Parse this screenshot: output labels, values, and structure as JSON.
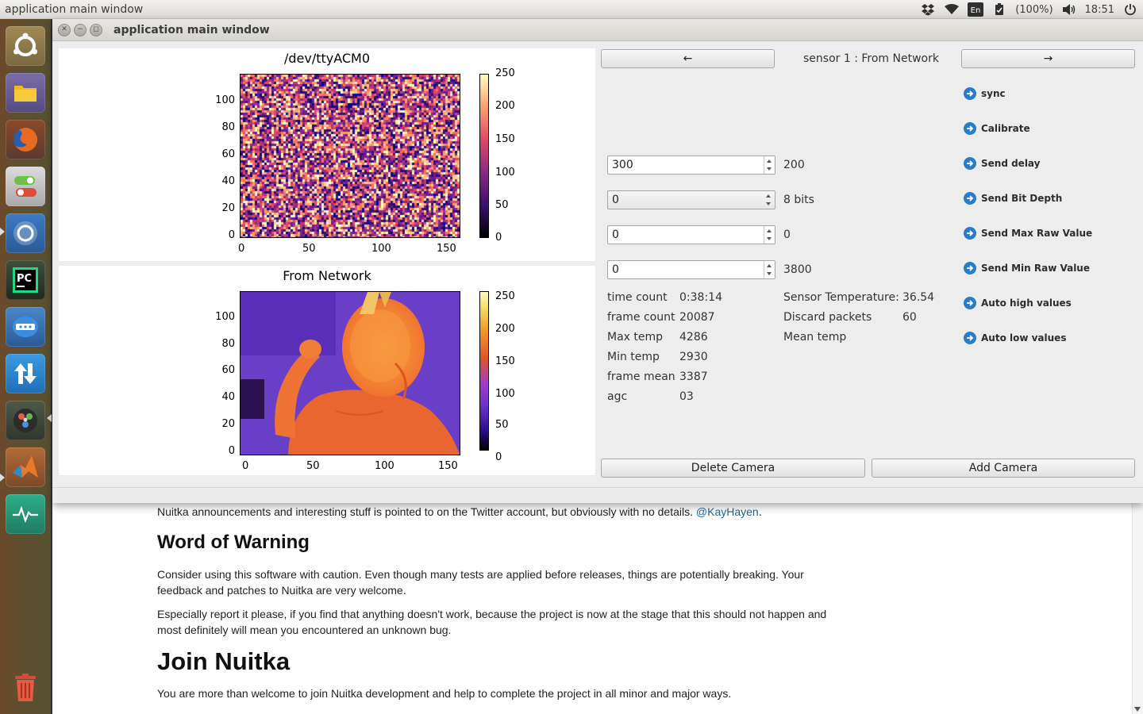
{
  "top_panel": {
    "title": "application main window",
    "keyboard": "En",
    "battery": "(100%)",
    "clock": "18:51"
  },
  "window": {
    "title": "application main window"
  },
  "plot_top": {
    "title": "/dev/ttyACM0",
    "y_ticks": [
      "100",
      "80",
      "60",
      "40",
      "20",
      "0"
    ],
    "x_ticks": [
      "0",
      "50",
      "100",
      "150"
    ],
    "cbar_ticks": [
      "250",
      "200",
      "150",
      "100",
      "50",
      "0"
    ]
  },
  "plot_bottom": {
    "title": "From Network",
    "y_ticks": [
      "100",
      "80",
      "60",
      "40",
      "20",
      "0"
    ],
    "x_ticks": [
      "0",
      "50",
      "100",
      "150"
    ],
    "cbar_ticks": [
      "250",
      "200",
      "150",
      "100",
      "50",
      "0"
    ]
  },
  "nav": {
    "prev_label": "←",
    "next_label": "→",
    "sensor_label": "sensor 1 : From Network"
  },
  "inputs": {
    "send_delay": {
      "value": "300",
      "readout": "200"
    },
    "bit_depth": {
      "value": "0",
      "readout": "8 bits"
    },
    "max_raw": {
      "value": "0",
      "readout": "0"
    },
    "min_raw": {
      "value": "0",
      "readout": "3800"
    }
  },
  "stats": {
    "time_count_label": "time count",
    "time_count": "0:38:14",
    "frame_count_label": "frame count",
    "frame_count": "20087",
    "max_temp_label": "Max temp",
    "max_temp": "4286",
    "min_temp_label": "Min temp",
    "min_temp": "2930",
    "frame_mean_label": "frame mean",
    "frame_mean": "3387",
    "agc_label": "agc",
    "agc": "03",
    "sensor_temp_label": "Sensor Temperature:",
    "sensor_temp": "36.54",
    "discard_label": "Discard packets",
    "discard": "60",
    "mean_temp_label": "Mean temp"
  },
  "commands": [
    "sync",
    "Calibrate",
    "Send delay",
    "Send Bit Depth",
    "Send Max Raw Value",
    "Send Min Raw Value",
    "Auto high values",
    "Auto low values"
  ],
  "bottom_buttons": {
    "delete": "Delete Camera",
    "add": "Add Camera"
  },
  "browser": {
    "intro": "Nuitka announcements and interesting stuff is pointed to on the Twitter account, but obviously with no details.",
    "intro_link": "@KayHayen",
    "h_warning": "Word of Warning",
    "p_warning": "Consider using this software with caution. Even though many tests are applied before releases, things are potentially breaking. Your feedback and patches to Nuitka are very welcome.",
    "p_report": "Especially report it please, if you find that anything doesn't work, because the project is now at the stage that this should not happen and most definitely will mean you encountered an unknown bug.",
    "h_join": "Join Nuitka",
    "p_join": "You are more than welcome to join Nuitka development and help to complete the project in all minor and major ways."
  },
  "colors": {
    "launcher": "#5c5030",
    "cmd_icon": "#2b7cc8",
    "link": "#1a6496"
  },
  "icons": [
    "ubuntu-logo-icon",
    "files-icon",
    "firefox-icon",
    "settings-toggle-icon",
    "chromium-icon",
    "pycharm-icon",
    "remmina-icon",
    "transfer-icon",
    "unity-tweak-icon",
    "matlab-icon",
    "system-monitor-icon",
    "trash-icon",
    "dropbox-icon",
    "wifi-icon",
    "keyboard-icon",
    "battery-icon",
    "volume-icon",
    "power-icon"
  ]
}
